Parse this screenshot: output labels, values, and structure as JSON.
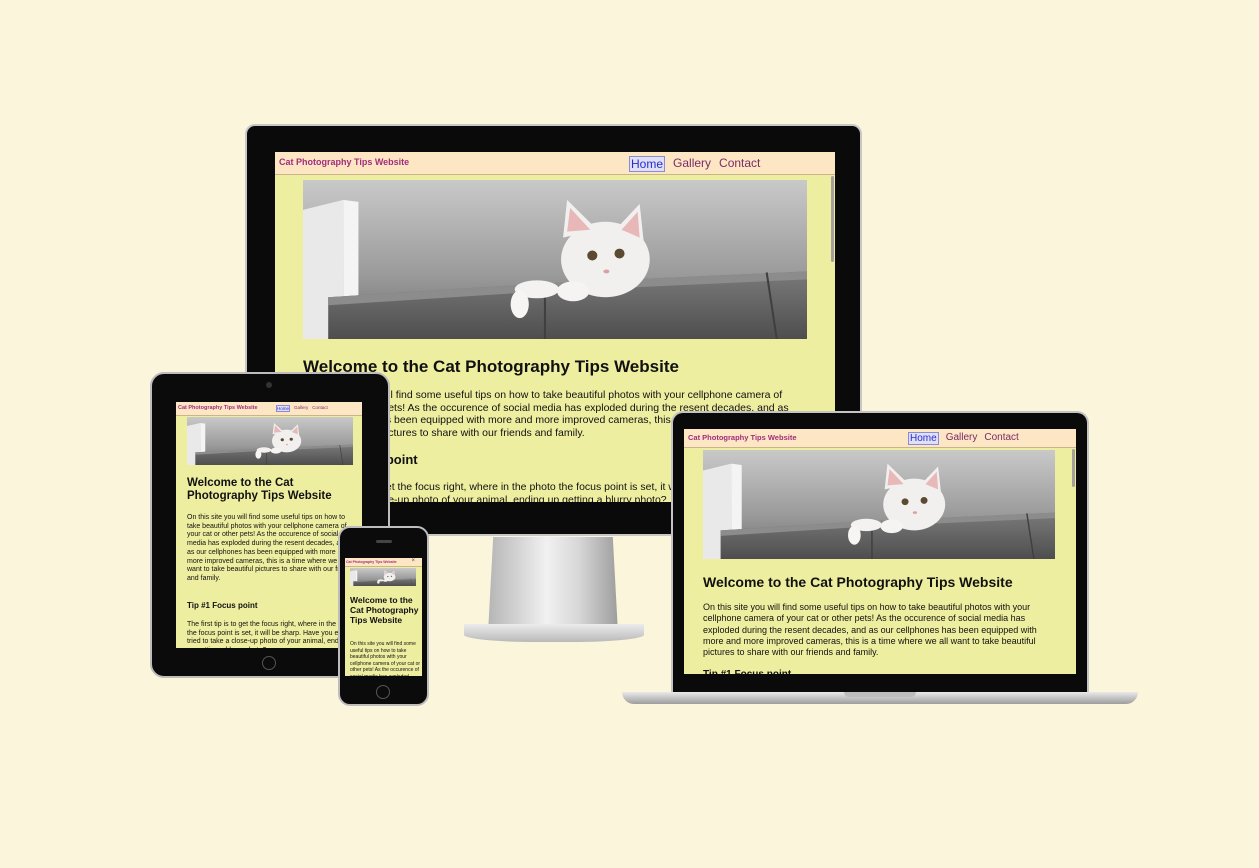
{
  "site": {
    "brand": "Cat Photography Tips Website",
    "nav": [
      "Home",
      "Gallery",
      "Contact"
    ],
    "active_nav": "Home",
    "heading": "Welcome to the Cat Photography Tips Website",
    "intro": "On this site you will find some useful tips on how to take beautiful photos with your cellphone camera of your cat or other pets! As the occurence of social media has exploded during the resent decades, and as our cellphones has been equipped with more and more improved cameras, this is a time where we all want to take beautiful pictures to share with our friends and family.",
    "tip1_heading": "Tip #1 Focus point",
    "tip1_text": "The first tip is to get the focus right, where in the photo the focus point is set, it will be sharp. Have you ever tried to take a close-up photo of your animal, ending up getting a blurry photo?"
  },
  "colors": {
    "page_bg": "#fbf5dc",
    "site_bg": "#eeeea0",
    "nav_bg": "#fde6c4",
    "brand": "#a12d7a",
    "link": "#7b2a66",
    "active_link": "#2b2bd6"
  },
  "devices": [
    "desktop-monitor",
    "tablet",
    "phone",
    "laptop"
  ]
}
